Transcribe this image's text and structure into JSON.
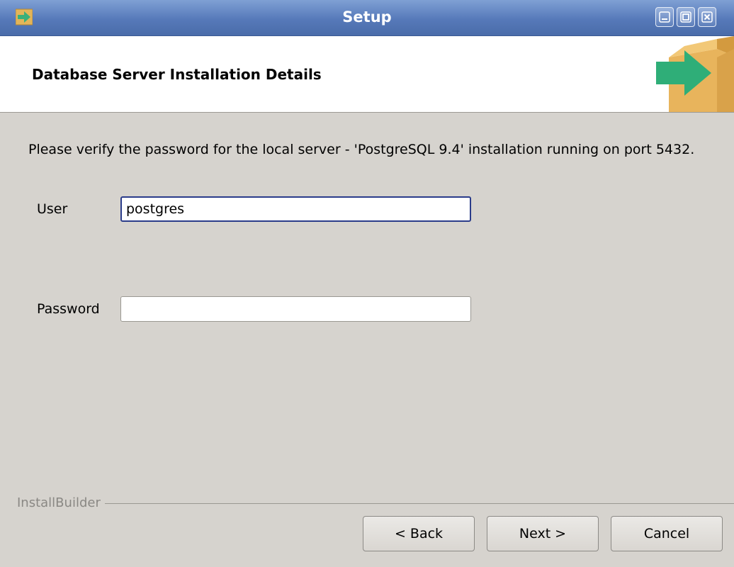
{
  "window": {
    "title": "Setup",
    "icons": {
      "app": "installer-arrow-icon",
      "minimize": "minimize-icon",
      "maximize": "maximize-icon",
      "close": "close-icon"
    }
  },
  "header": {
    "title": "Database Server Installation Details",
    "logo_icon": "package-arrow-icon"
  },
  "main": {
    "description": "Please verify the password for the local server - 'PostgreSQL 9.4' installation running on port 5432.",
    "user": {
      "label": "User",
      "value": "postgres"
    },
    "password": {
      "label": "Password",
      "value": ""
    }
  },
  "footer": {
    "brand": "InstallBuilder",
    "back_label": "< Back",
    "next_label": "Next >",
    "cancel_label": "Cancel"
  },
  "colors": {
    "accent": "#2b3c8a",
    "titlebar": "#5679b9",
    "background": "#d6d3ce"
  }
}
